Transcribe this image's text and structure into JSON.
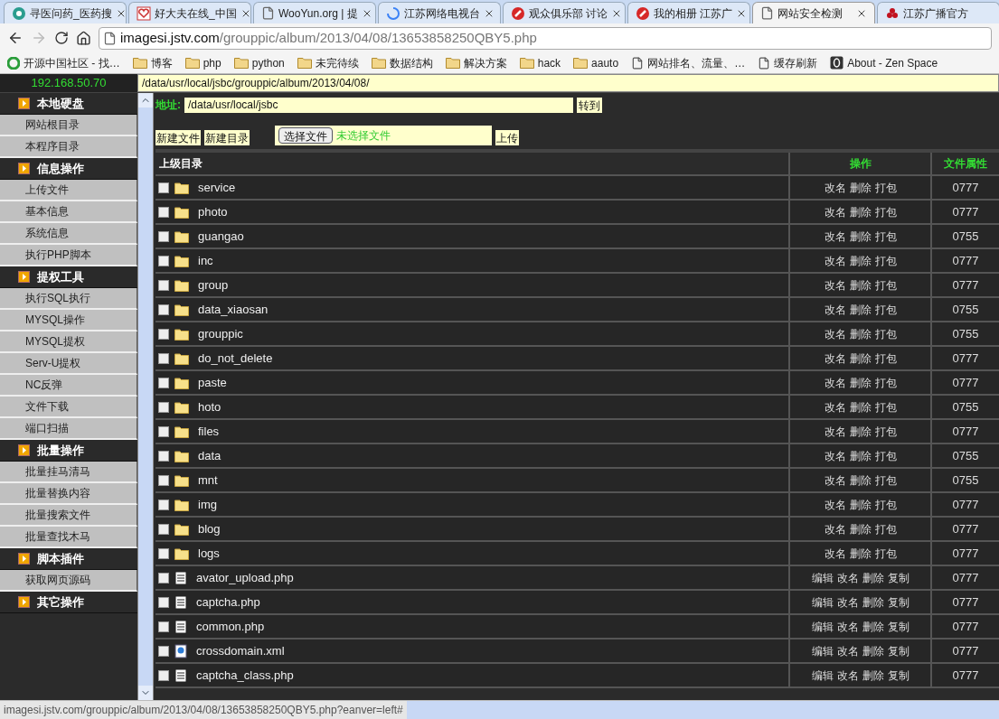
{
  "browser": {
    "tabs": [
      {
        "title": "寻医问药_医药搜",
        "kind": "globe",
        "selected": false
      },
      {
        "title": "好大夫在线_中国",
        "kind": "heart",
        "selected": false
      },
      {
        "title": "WooYun.org | 提",
        "kind": "page",
        "selected": false
      },
      {
        "title": "江苏网络电视台",
        "kind": "loading",
        "selected": false
      },
      {
        "title": "观众俱乐部 讨论",
        "kind": "red",
        "selected": false
      },
      {
        "title": "我的相册 江苏广",
        "kind": "red",
        "selected": false
      },
      {
        "title": "网站安全检测",
        "kind": "page",
        "selected": true
      },
      {
        "title": "江苏广播官方",
        "kind": "flower",
        "selected": false
      }
    ],
    "address": {
      "host": "imagesi.jstv.com",
      "path": "/grouppic/album/2013/04/08/13653858250QBY5.php"
    },
    "bookmarks": [
      {
        "label": "开源中国社区 - 找…",
        "kind": "site"
      },
      {
        "label": "博客",
        "kind": "folder"
      },
      {
        "label": "php",
        "kind": "folder"
      },
      {
        "label": "python",
        "kind": "folder"
      },
      {
        "label": "未完待续",
        "kind": "folder"
      },
      {
        "label": "数据结构",
        "kind": "folder"
      },
      {
        "label": "解决方案",
        "kind": "folder"
      },
      {
        "label": "hack",
        "kind": "folder"
      },
      {
        "label": "aauto",
        "kind": "folder"
      },
      {
        "label": "网站排名、流量、…",
        "kind": "page"
      },
      {
        "label": "缓存刷新",
        "kind": "page"
      },
      {
        "label": "About - Zen Space",
        "kind": "zen"
      }
    ],
    "status_bar": "imagesi.jstv.com/grouppic/album/2013/04/08/13653858250QBY5.php?eanver=left#"
  },
  "page": {
    "server_ip": "192.168.50.70",
    "current_path": "/data/usr/local/jsbc/grouppic/album/2013/04/08/",
    "sidebar": [
      {
        "title": "本地硬盘",
        "items": [
          "网站根目录",
          "本程序目录"
        ]
      },
      {
        "title": "信息操作",
        "items": [
          "上传文件",
          "基本信息",
          "系统信息",
          "执行PHP脚本"
        ]
      },
      {
        "title": "提权工具",
        "items": [
          "执行SQL执行",
          "MYSQL操作",
          "MYSQL提权",
          "Serv-U提权",
          "NC反弹",
          "文件下载",
          "端口扫描"
        ]
      },
      {
        "title": "批量操作",
        "items": [
          "批量挂马清马",
          "批量替换内容",
          "批量搜索文件",
          "批量查找木马"
        ]
      },
      {
        "title": "脚本插件",
        "items": [
          "获取网页源码"
        ]
      },
      {
        "title": "其它操作"
      }
    ],
    "address_label": "地址:",
    "address_value": "/data/usr/local/jsbc",
    "go_button": "转到",
    "new_file_button": "新建文件",
    "new_dir_button": "新建目录",
    "choose_file_button": "选择文件",
    "no_file_text": "未选择文件",
    "upload_button": "上传",
    "table": {
      "columns": [
        "上级目录",
        "操作",
        "文件属性"
      ],
      "rows": [
        {
          "name": "service",
          "kind": "folder",
          "actions": [
            "改名",
            "删除",
            "打包"
          ],
          "mode": "0777",
          "checked": false
        },
        {
          "name": "photo",
          "kind": "folder",
          "actions": [
            "改名",
            "删除",
            "打包"
          ],
          "mode": "0777",
          "checked": false
        },
        {
          "name": "guangao",
          "kind": "folder",
          "actions": [
            "改名",
            "删除",
            "打包"
          ],
          "mode": "0755",
          "checked": false
        },
        {
          "name": "inc",
          "kind": "folder",
          "actions": [
            "改名",
            "删除",
            "打包"
          ],
          "mode": "0777",
          "checked": false
        },
        {
          "name": "group",
          "kind": "folder",
          "actions": [
            "改名",
            "删除",
            "打包"
          ],
          "mode": "0777",
          "checked": false
        },
        {
          "name": "data_xiaosan",
          "kind": "folder",
          "actions": [
            "改名",
            "删除",
            "打包"
          ],
          "mode": "0755",
          "checked": false
        },
        {
          "name": "grouppic",
          "kind": "folder",
          "actions": [
            "改名",
            "删除",
            "打包"
          ],
          "mode": "0755",
          "checked": false
        },
        {
          "name": "do_not_delete",
          "kind": "folder",
          "actions": [
            "改名",
            "删除",
            "打包"
          ],
          "mode": "0777",
          "checked": false
        },
        {
          "name": "paste",
          "kind": "folder",
          "actions": [
            "改名",
            "删除",
            "打包"
          ],
          "mode": "0777",
          "checked": false
        },
        {
          "name": "hoto",
          "kind": "folder",
          "actions": [
            "改名",
            "删除",
            "打包"
          ],
          "mode": "0755",
          "checked": false
        },
        {
          "name": "files",
          "kind": "folder",
          "actions": [
            "改名",
            "删除",
            "打包"
          ],
          "mode": "0777",
          "checked": false
        },
        {
          "name": "data",
          "kind": "folder",
          "actions": [
            "改名",
            "删除",
            "打包"
          ],
          "mode": "0755",
          "checked": false
        },
        {
          "name": "mnt",
          "kind": "folder",
          "actions": [
            "改名",
            "删除",
            "打包"
          ],
          "mode": "0755",
          "checked": false
        },
        {
          "name": "img",
          "kind": "folder",
          "actions": [
            "改名",
            "删除",
            "打包"
          ],
          "mode": "0777",
          "checked": false
        },
        {
          "name": "blog",
          "kind": "folder",
          "actions": [
            "改名",
            "删除",
            "打包"
          ],
          "mode": "0777",
          "checked": false
        },
        {
          "name": "logs",
          "kind": "folder",
          "actions": [
            "改名",
            "删除",
            "打包"
          ],
          "mode": "0777",
          "checked": false
        },
        {
          "name": "avator_upload.php",
          "kind": "text",
          "actions": [
            "编辑",
            "改名",
            "删除",
            "复制"
          ],
          "mode": "0777",
          "checked": false
        },
        {
          "name": "captcha.php",
          "kind": "text",
          "actions": [
            "编辑",
            "改名",
            "删除",
            "复制"
          ],
          "mode": "0777",
          "checked": false
        },
        {
          "name": "common.php",
          "kind": "text",
          "actions": [
            "编辑",
            "改名",
            "删除",
            "复制"
          ],
          "mode": "0777",
          "checked": false
        },
        {
          "name": "crossdomain.xml",
          "kind": "xml",
          "actions": [
            "编辑",
            "改名",
            "删除",
            "复制"
          ],
          "mode": "0777",
          "checked": false
        },
        {
          "name": "captcha_class.php",
          "kind": "text",
          "actions": [
            "编辑",
            "改名",
            "删除",
            "复制"
          ],
          "mode": "0777",
          "checked": false
        }
      ]
    }
  }
}
